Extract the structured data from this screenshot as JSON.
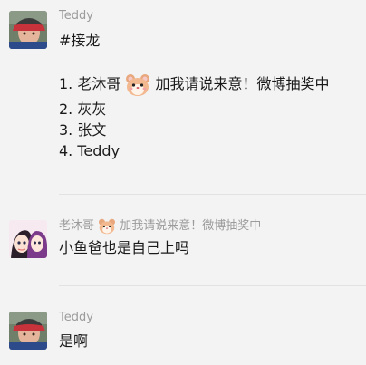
{
  "messages": [
    {
      "sender": "Teddy",
      "lines": {
        "l1": "#接龙",
        "l2_prefix": "1. 老沐哥",
        "l2_suffix": "加我请说来意！微博抽奖中",
        "l3": "2. 灰灰",
        "l4": "3. 张文",
        "l5": "4. Teddy"
      }
    },
    {
      "sender_prefix": "老沐哥",
      "sender_suffix": "加我请说来意！微博抽奖中",
      "text": "小鱼爸也是自己上吗"
    },
    {
      "sender": "Teddy",
      "text": "是啊"
    }
  ],
  "icons": {
    "hamster": "hamster-emoji-icon"
  },
  "colors": {
    "background": "#f3f3f3",
    "sender_name": "#9b9b9b",
    "divider": "#e2e2e2"
  }
}
